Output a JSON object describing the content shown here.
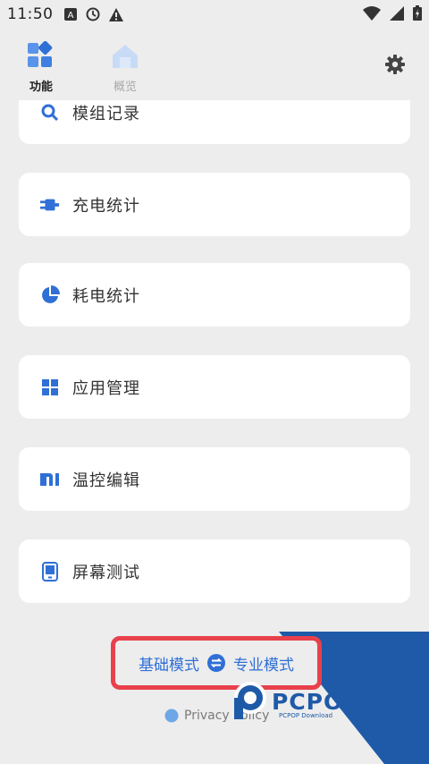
{
  "status_bar": {
    "time": "11:50"
  },
  "nav": {
    "tab_features": "功能",
    "tab_overview": "概览"
  },
  "cards": {
    "record": "模组记录",
    "charge": "充电统计",
    "consumption": "耗电统计",
    "apps": "应用管理",
    "thermal": "温控编辑",
    "screen": "屏幕测试"
  },
  "mode": {
    "basic": "基础模式",
    "pro": "专业模式"
  },
  "footer": {
    "privacy": "Privacy Policy"
  },
  "watermark": {
    "brand": "PCPOP下载",
    "sub": "PCPOP Download"
  },
  "colors": {
    "accent": "#2f6fd6",
    "highlight_border": "#e8414c",
    "background": "#ededed"
  }
}
